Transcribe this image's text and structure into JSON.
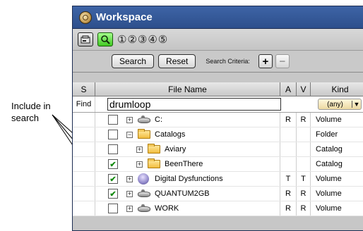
{
  "annotation": {
    "line1": "Include in",
    "line2": "search"
  },
  "window": {
    "title": "Workspace"
  },
  "toolbar": {
    "circled_numbers": "①②③④⑤"
  },
  "search_bar": {
    "search_label": "Search",
    "reset_label": "Reset",
    "criteria_label": "Search Criteria:",
    "plus_label": "+",
    "minus_label": "−"
  },
  "columns": {
    "s": "S",
    "name": "File Name",
    "a": "A",
    "v": "V",
    "kind": "Kind"
  },
  "find": {
    "label": "Find",
    "value": "drumloop",
    "kind_value": "(any)",
    "kind_arrow": "▼"
  },
  "rows": [
    {
      "name": "C:",
      "a": "R",
      "v": "R",
      "kind": "Volume",
      "checked": false,
      "expander": "+",
      "icon": "drive-icon"
    },
    {
      "name": "Catalogs",
      "a": "",
      "v": "",
      "kind": "Folder",
      "checked": false,
      "expander": "−",
      "icon": "folder-icon"
    },
    {
      "name": "Aviary",
      "a": "",
      "v": "",
      "kind": "Catalog",
      "checked": false,
      "expander": "+",
      "icon": "folder-icon"
    },
    {
      "name": "BeenThere",
      "a": "",
      "v": "",
      "kind": "Catalog",
      "checked": true,
      "expander": "+",
      "icon": "folder-icon"
    },
    {
      "name": "Digital Dysfunctions",
      "a": "T",
      "v": "T",
      "kind": "Volume",
      "checked": true,
      "expander": "+",
      "icon": "person-disk-icon"
    },
    {
      "name": "QUANTUM2GB",
      "a": "R",
      "v": "R",
      "kind": "Volume",
      "checked": true,
      "expander": "+",
      "icon": "drive-icon"
    },
    {
      "name": "WORK",
      "a": "R",
      "v": "R",
      "kind": "Volume",
      "checked": false,
      "expander": "+",
      "icon": "drive-icon"
    }
  ]
}
